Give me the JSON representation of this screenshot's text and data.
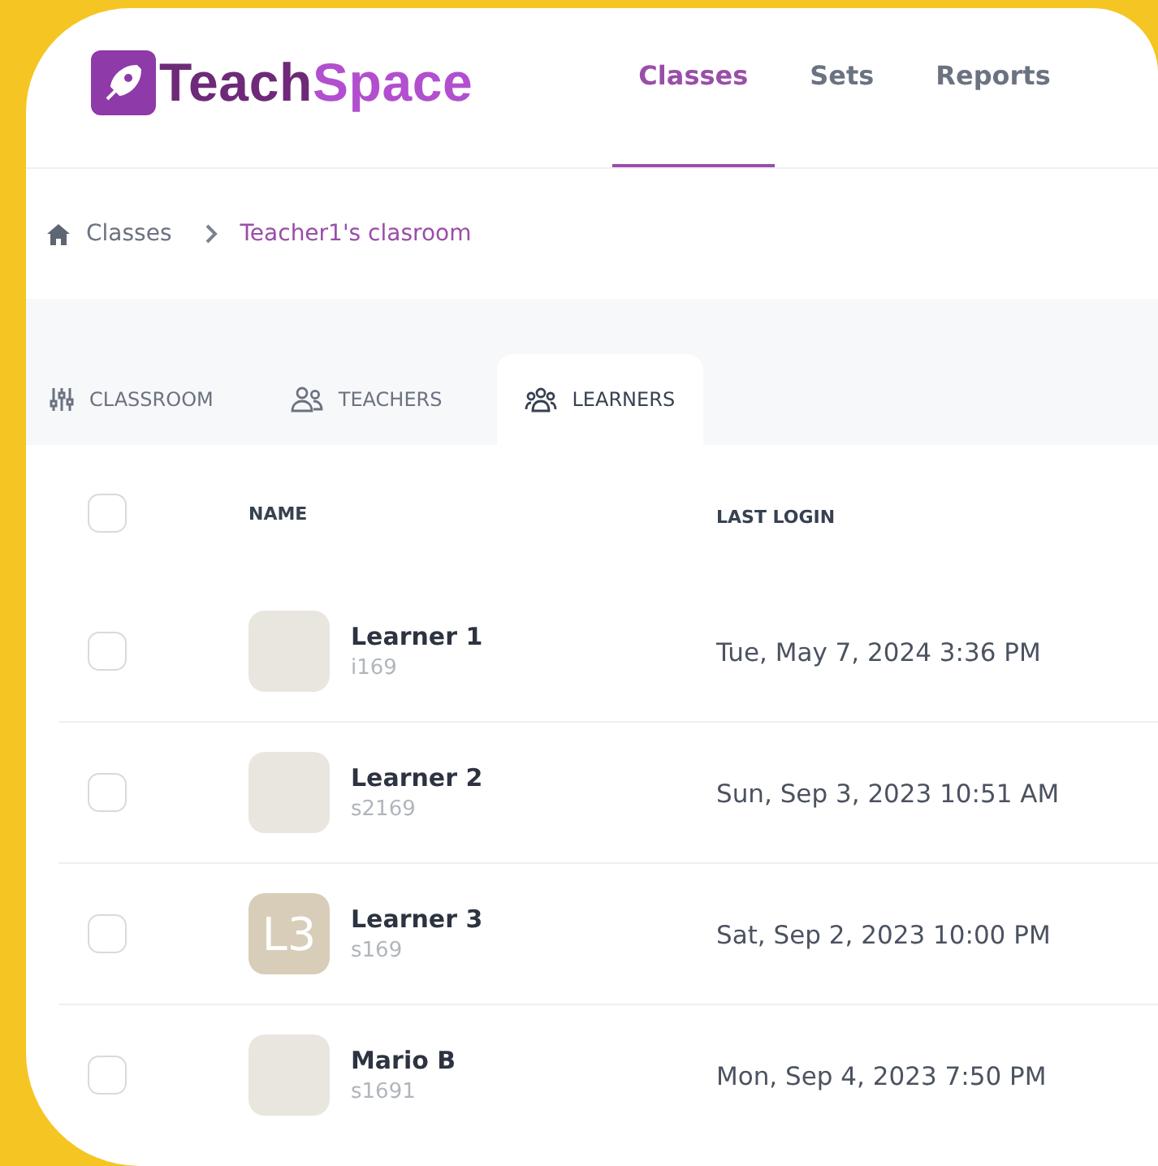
{
  "logo": {
    "first": "Teach",
    "second": "Space"
  },
  "nav": [
    {
      "label": "Classes",
      "selected": true
    },
    {
      "label": "Sets",
      "selected": false
    },
    {
      "label": "Reports",
      "selected": false
    }
  ],
  "breadcrumb": [
    {
      "label": "Classes",
      "current": false
    },
    {
      "label": "Teacher1's clasroom",
      "current": true
    }
  ],
  "tabs": [
    {
      "label": "CLASSROOM",
      "kind": "sliders",
      "selected": false
    },
    {
      "label": "TEACHERS",
      "kind": "people",
      "selected": false
    },
    {
      "label": "LEARNERS",
      "kind": "group",
      "selected": true
    }
  ],
  "table": {
    "select_all": {
      "checked": false
    },
    "columns": [
      "NAME",
      "LAST LOGIN"
    ],
    "rows": [
      {
        "checked": false,
        "avatar": {
          "kind": "picture"
        },
        "name": "Learner 1",
        "username": "i169",
        "last_login": "Tue, May 7, 2024 3:36 PM"
      },
      {
        "checked": false,
        "avatar": {
          "kind": "picture"
        },
        "name": "Learner 2",
        "username": "s2169",
        "last_login": "Sun, Sep 3, 2023 10:51 AM"
      },
      {
        "checked": false,
        "avatar": {
          "kind": "initials",
          "text": "L3"
        },
        "name": "Learner 3",
        "username": "s169",
        "last_login": "Sat, Sep 2, 2023 10:00 PM"
      },
      {
        "checked": false,
        "avatar": {
          "kind": "picture"
        },
        "name": "Mario B",
        "username": "s1691",
        "last_login": "Mon, Sep 4, 2023 7:50 PM"
      }
    ]
  }
}
